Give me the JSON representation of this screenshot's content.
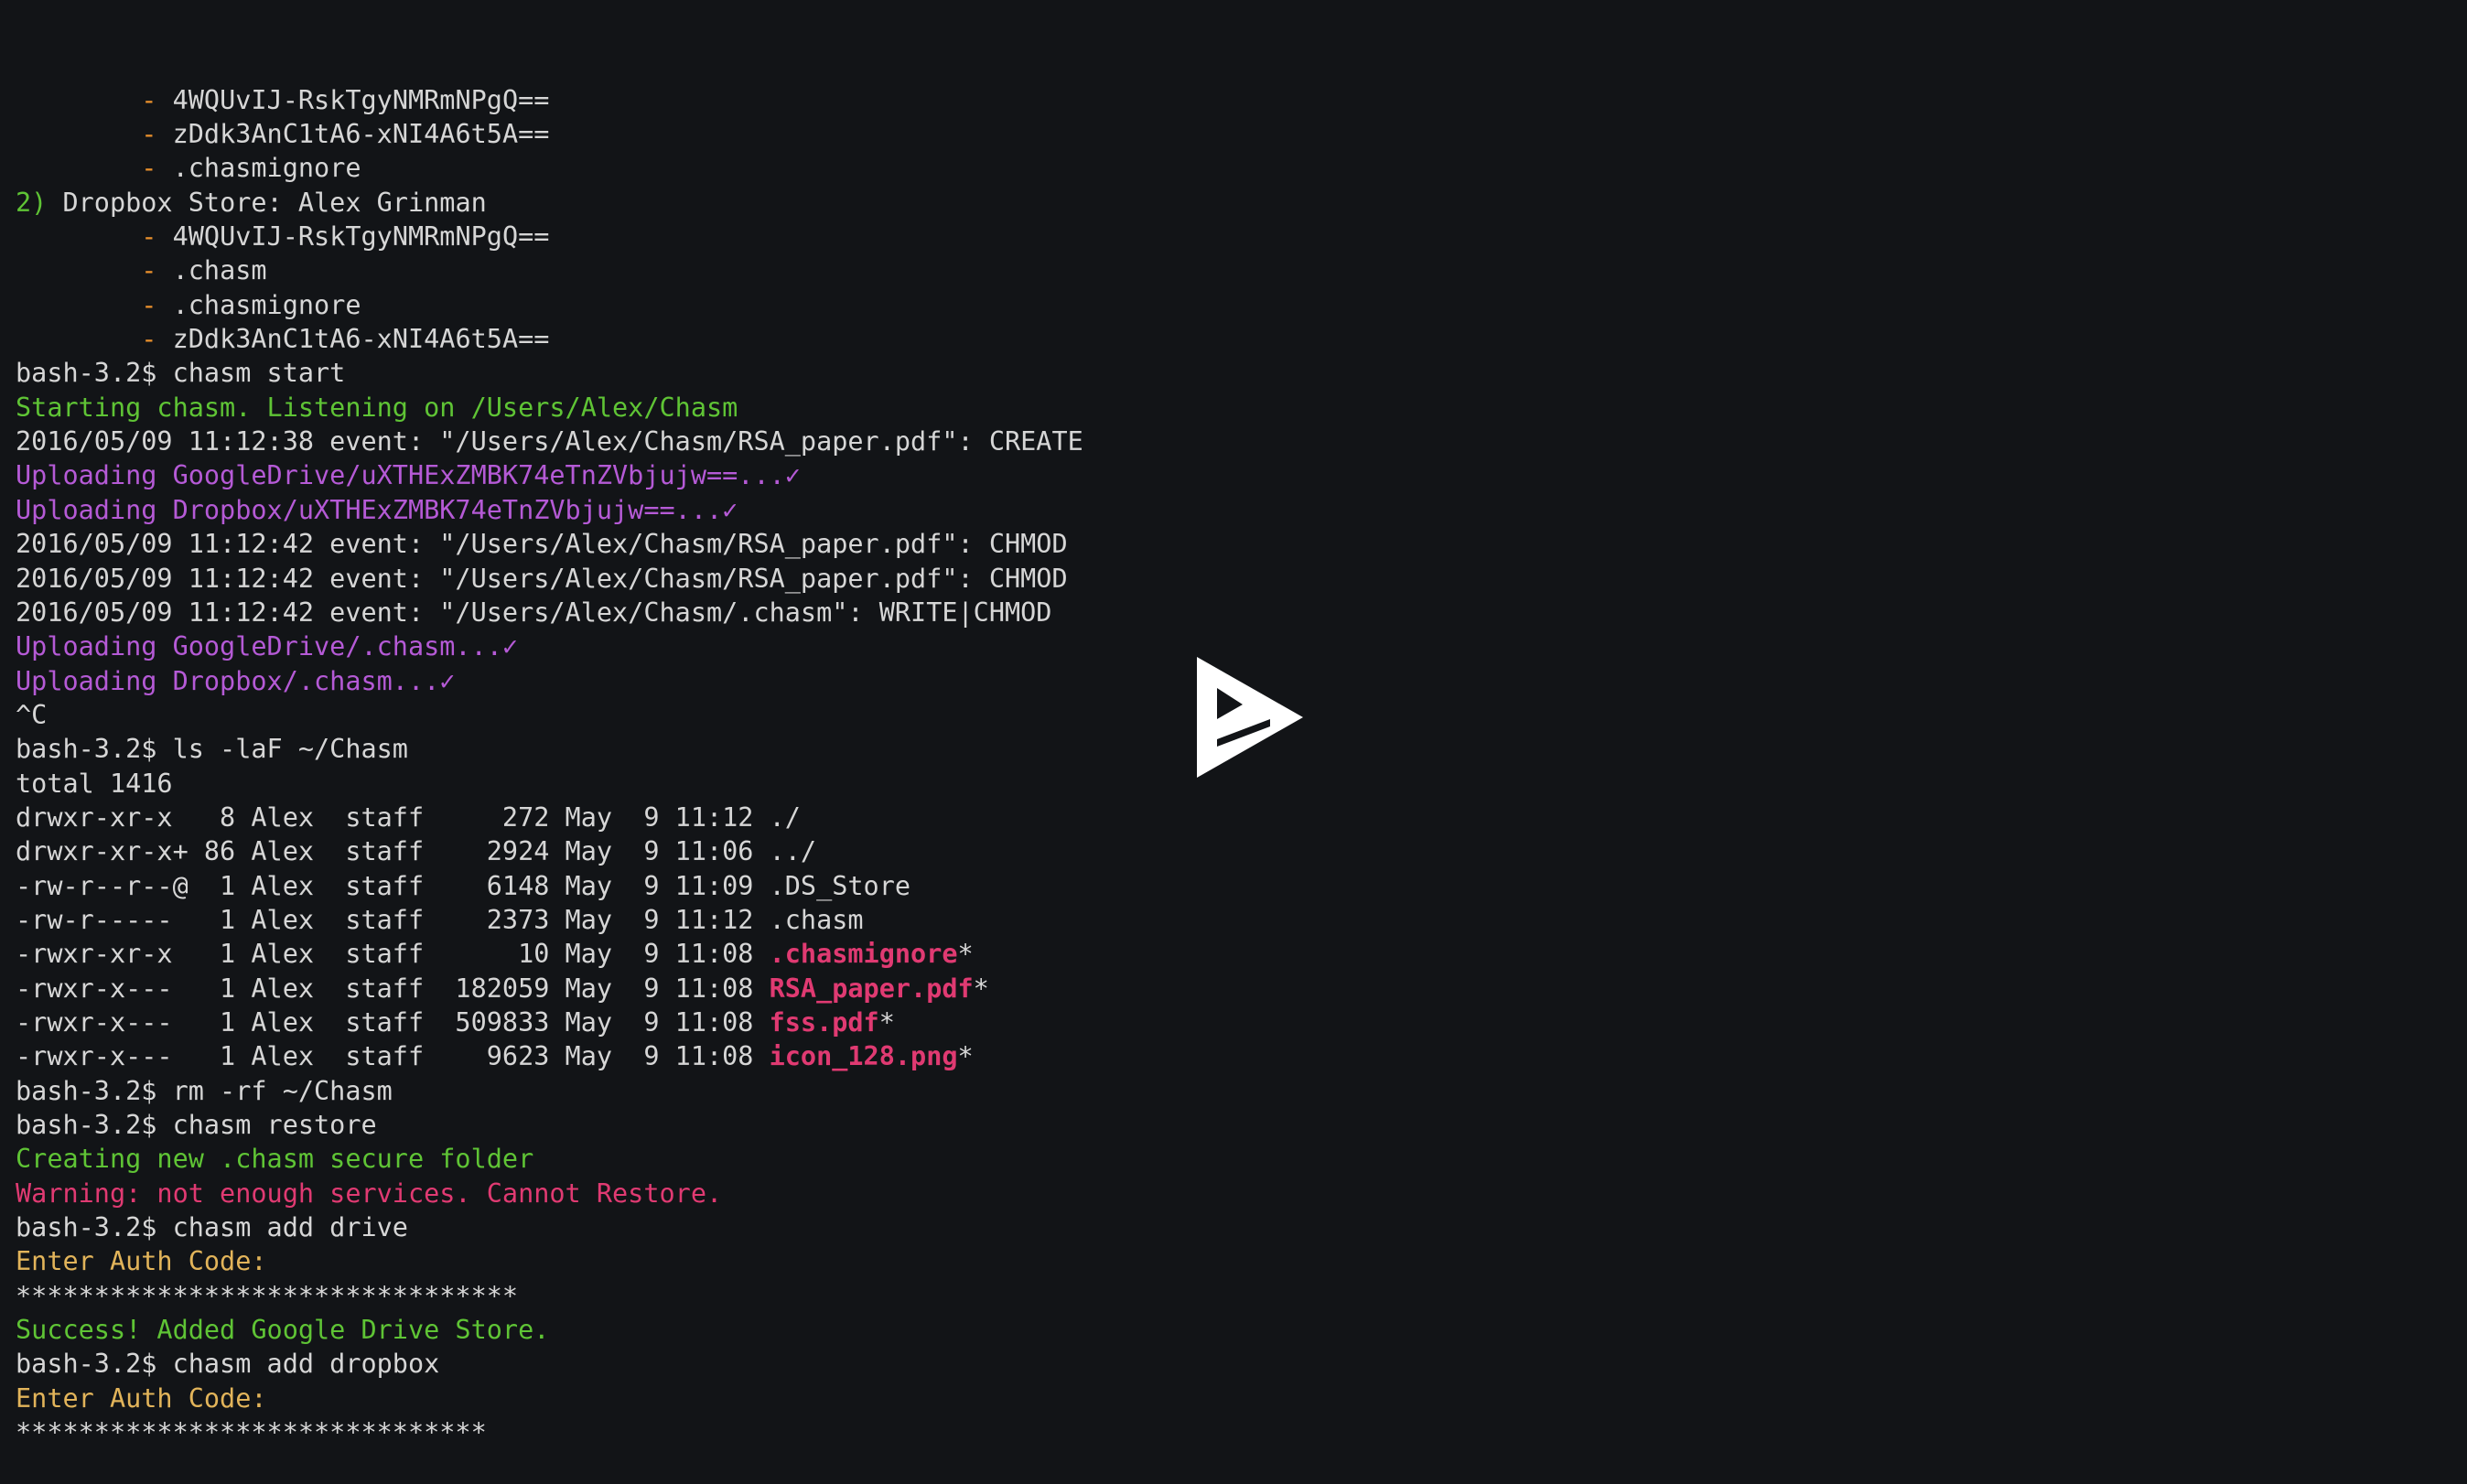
{
  "terminal": {
    "background": "#121417",
    "colors": {
      "default": "#d6d6d6",
      "green": "#5fc435",
      "magenta": "#b55ad6",
      "orange": "#e8902c",
      "red": "#e03a72",
      "yellow": "#e2b45a"
    },
    "lines": [
      [
        {
          "t": "        ",
          "c": "default"
        },
        {
          "t": "-",
          "c": "orange"
        },
        {
          "t": " 4WQUvIJ-RskTgyNMRmNPgQ==",
          "c": "default"
        }
      ],
      [
        {
          "t": "        ",
          "c": "default"
        },
        {
          "t": "-",
          "c": "orange"
        },
        {
          "t": " zDdk3AnC1tA6-xNI4A6t5A==",
          "c": "default"
        }
      ],
      [
        {
          "t": "        ",
          "c": "default"
        },
        {
          "t": "-",
          "c": "orange"
        },
        {
          "t": " .chasmignore",
          "c": "default"
        }
      ],
      [
        {
          "t": "2)",
          "c": "green"
        },
        {
          "t": " Dropbox Store: Alex Grinman",
          "c": "default"
        }
      ],
      [
        {
          "t": "        ",
          "c": "default"
        },
        {
          "t": "-",
          "c": "orange"
        },
        {
          "t": " 4WQUvIJ-RskTgyNMRmNPgQ==",
          "c": "default"
        }
      ],
      [
        {
          "t": "        ",
          "c": "default"
        },
        {
          "t": "-",
          "c": "orange"
        },
        {
          "t": " .chasm",
          "c": "default"
        }
      ],
      [
        {
          "t": "        ",
          "c": "default"
        },
        {
          "t": "-",
          "c": "orange"
        },
        {
          "t": " .chasmignore",
          "c": "default"
        }
      ],
      [
        {
          "t": "        ",
          "c": "default"
        },
        {
          "t": "-",
          "c": "orange"
        },
        {
          "t": " zDdk3AnC1tA6-xNI4A6t5A==",
          "c": "default"
        }
      ],
      [
        {
          "t": "bash-3.2$ chasm start",
          "c": "default"
        }
      ],
      [
        {
          "t": "Starting chasm. Listening on /Users/Alex/Chasm",
          "c": "green"
        }
      ],
      [
        {
          "t": "2016/05/09 11:12:38 event: \"/Users/Alex/Chasm/RSA_paper.pdf\": CREATE",
          "c": "default"
        }
      ],
      [
        {
          "t": "Uploading GoogleDrive/uXTHExZMBK74eTnZVbjujw==...✓",
          "c": "magenta"
        }
      ],
      [
        {
          "t": "Uploading Dropbox/uXTHExZMBK74eTnZVbjujw==...✓",
          "c": "magenta"
        }
      ],
      [
        {
          "t": "2016/05/09 11:12:42 event: \"/Users/Alex/Chasm/RSA_paper.pdf\": CHMOD",
          "c": "default"
        }
      ],
      [
        {
          "t": "2016/05/09 11:12:42 event: \"/Users/Alex/Chasm/RSA_paper.pdf\": CHMOD",
          "c": "default"
        }
      ],
      [
        {
          "t": "2016/05/09 11:12:42 event: \"/Users/Alex/Chasm/.chasm\": WRITE|CHMOD",
          "c": "default"
        }
      ],
      [
        {
          "t": "Uploading GoogleDrive/.chasm...✓",
          "c": "magenta"
        }
      ],
      [
        {
          "t": "Uploading Dropbox/.chasm...✓",
          "c": "magenta"
        }
      ],
      [
        {
          "t": "^C",
          "c": "default"
        }
      ],
      [
        {
          "t": "bash-3.2$ ls -laF ~/Chasm",
          "c": "default"
        }
      ],
      [
        {
          "t": "total 1416",
          "c": "default"
        }
      ],
      [
        {
          "t": "drwxr-xr-x   8 Alex  staff     272 May  9 11:12 ./",
          "c": "default"
        }
      ],
      [
        {
          "t": "drwxr-xr-x+ 86 Alex  staff    2924 May  9 11:06 ../",
          "c": "default"
        }
      ],
      [
        {
          "t": "-rw-r--r--@  1 Alex  staff    6148 May  9 11:09 .DS_Store",
          "c": "default"
        }
      ],
      [
        {
          "t": "-rw-r-----   1 Alex  staff    2373 May  9 11:12 .chasm",
          "c": "default"
        }
      ],
      [
        {
          "t": "-rwxr-xr-x   1 Alex  staff      10 May  9 11:08 ",
          "c": "default"
        },
        {
          "t": ".chasmignore",
          "c": "red",
          "b": true
        },
        {
          "t": "*",
          "c": "default"
        }
      ],
      [
        {
          "t": "-rwxr-x---   1 Alex  staff  182059 May  9 11:08 ",
          "c": "default"
        },
        {
          "t": "RSA_paper.pdf",
          "c": "red",
          "b": true
        },
        {
          "t": "*",
          "c": "default"
        }
      ],
      [
        {
          "t": "-rwxr-x---   1 Alex  staff  509833 May  9 11:08 ",
          "c": "default"
        },
        {
          "t": "fss.pdf",
          "c": "red",
          "b": true
        },
        {
          "t": "*",
          "c": "default"
        }
      ],
      [
        {
          "t": "-rwxr-x---   1 Alex  staff    9623 May  9 11:08 ",
          "c": "default"
        },
        {
          "t": "icon_128.png",
          "c": "red",
          "b": true
        },
        {
          "t": "*",
          "c": "default"
        }
      ],
      [
        {
          "t": "bash-3.2$ rm -rf ~/Chasm",
          "c": "default"
        }
      ],
      [
        {
          "t": "bash-3.2$ chasm restore",
          "c": "default"
        }
      ],
      [
        {
          "t": "Creating new .chasm secure folder",
          "c": "green"
        }
      ],
      [
        {
          "t": "Warning: not enough services. Cannot Restore.",
          "c": "red"
        }
      ],
      [
        {
          "t": "bash-3.2$ chasm add drive",
          "c": "default"
        }
      ],
      [
        {
          "t": "Enter Auth Code:",
          "c": "yellow"
        }
      ],
      [
        {
          "t": "********************************",
          "c": "default"
        }
      ],
      [
        {
          "t": "Success! Added Google Drive Store.",
          "c": "green"
        }
      ],
      [
        {
          "t": "bash-3.2$ chasm add dropbox",
          "c": "default"
        }
      ],
      [
        {
          "t": "Enter Auth Code:",
          "c": "yellow"
        }
      ],
      [
        {
          "t": "******************************",
          "c": "default"
        }
      ]
    ]
  },
  "overlay": {
    "icon": "play-icon",
    "color": "#ffffff"
  }
}
